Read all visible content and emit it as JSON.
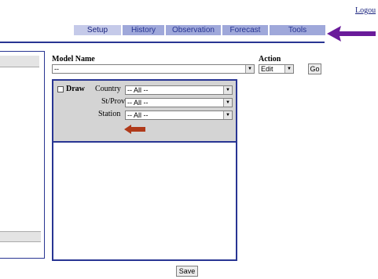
{
  "header": {
    "logout": "Logou"
  },
  "tabs": [
    "Setup",
    "History",
    "Observation",
    "Forecast",
    "Tools"
  ],
  "form": {
    "model_name_label": "Model Name",
    "model_name_value": "--",
    "action_label": "Action",
    "action_value": "Edit",
    "go_label": "Go"
  },
  "filters": {
    "draw_label": "Draw",
    "country_label": "Country",
    "country_value": "-- All --",
    "stprov_label": "St/Prov",
    "stprov_value": "-- All --",
    "station_label": "Station",
    "station_value": "-- All --"
  },
  "save_label": "Save",
  "colors": {
    "tab_bg": "#9fa8da",
    "tab_text": "#283593",
    "annotation_arrow": "#6a1b9a",
    "inline_arrow": "#b03a1a"
  }
}
